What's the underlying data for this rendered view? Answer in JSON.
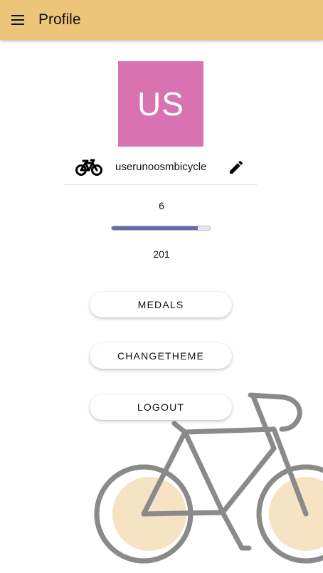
{
  "appbar": {
    "title": "Profile",
    "menu_icon": "menu-icon",
    "color": "#ecc57b"
  },
  "profile": {
    "avatar_initials": "US",
    "avatar_color": "#d872b0",
    "vehicle_icon": "bicycle-icon",
    "username": "userunoosmbicycle",
    "edit_icon": "edit-pencil-icon",
    "level": "6",
    "progress_fraction": 0.88,
    "progress_color": "#6a6aa8",
    "points": "201"
  },
  "actions": {
    "medals_label": "MEDALS",
    "change_theme_label": "CHANGETHEME",
    "logout_label": "LOGOUT"
  },
  "background": {
    "illustration": "bicycle-illustration",
    "frame_color": "#8a8a8a",
    "wheel_fill_color": "#f5e3c3"
  }
}
